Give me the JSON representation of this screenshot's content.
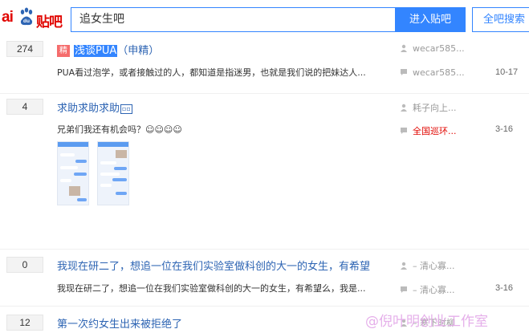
{
  "header": {
    "logo_bai": "ai",
    "logo_du": "du",
    "logo_tieba": "贴吧",
    "search_value": "追女生吧",
    "enter_button": "进入贴吧",
    "search_all_button": "全吧搜索"
  },
  "threads": [
    {
      "reply_count": "274",
      "badge": "精",
      "title_highlight": "浅谈PUA",
      "title_rest": "（申精）",
      "abstract": "PUA看过泡学，或者接触过的人，都知道是指迷男，也就是我们说的把妹达人...",
      "author": "wecar585...",
      "last_reply": "wecar585...",
      "date": "10-17"
    },
    {
      "reply_count": "4",
      "title": "求助求助求助",
      "title_emoji": "▫▫",
      "abstract": "兄弟们我还有机会吗？☺☺☺☺",
      "author": "耗子向上...",
      "last_reply": "全国巡环...",
      "date": "3-16"
    },
    {
      "reply_count": "0",
      "title": "我现在研二了，想追一位在我们实验室做科创的大一的女生，有希望",
      "abstract": "我现在研二了，想追一位在我们实验室做科创的大一的女生，有希望么，我是...",
      "author": "– 清心寡...",
      "last_reply": "– 清心寡...",
      "date": "3-16"
    },
    {
      "reply_count": "12",
      "title": "第一次约女生出来被拒绝了",
      "author": "– 寒下时柳"
    }
  ],
  "watermark": "@倪叶明创业工作室",
  "colors": {
    "accent": "#3385ff",
    "title": "#2d64b3",
    "logo": "#e10601",
    "badge": "#f56c6c"
  }
}
